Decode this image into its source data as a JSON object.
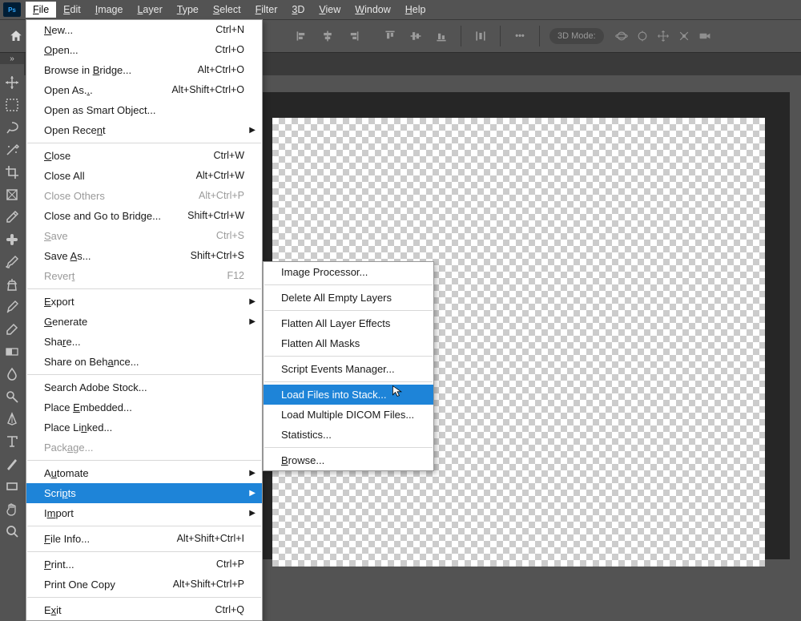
{
  "app": {
    "logo_text": "Ps"
  },
  "menubar": [
    "File",
    "Edit",
    "Image",
    "Layer",
    "Type",
    "Select",
    "Filter",
    "3D",
    "View",
    "Window",
    "Help"
  ],
  "optionsbar": {
    "mode_label": "3D Mode:"
  },
  "file_menu": {
    "groups": [
      [
        {
          "label": "New...",
          "u": 0,
          "shortcut": "Ctrl+N"
        },
        {
          "label": "Open...",
          "u": 0,
          "shortcut": "Ctrl+O"
        },
        {
          "label": "Browse in Bridge...",
          "u": 10,
          "shortcut": "Alt+Ctrl+O"
        },
        {
          "label": "Open As...",
          "u": 8,
          "shortcut": "Alt+Shift+Ctrl+O"
        },
        {
          "label": "Open as Smart Object..."
        },
        {
          "label": "Open Recent",
          "u": 9,
          "submenu": true
        }
      ],
      [
        {
          "label": "Close",
          "u": 0,
          "shortcut": "Ctrl+W"
        },
        {
          "label": "Close All",
          "shortcut": "Alt+Ctrl+W"
        },
        {
          "label": "Close Others",
          "shortcut": "Alt+Ctrl+P",
          "disabled": true
        },
        {
          "label": "Close and Go to Bridge...",
          "shortcut": "Shift+Ctrl+W"
        },
        {
          "label": "Save",
          "u": 0,
          "shortcut": "Ctrl+S",
          "disabled": true
        },
        {
          "label": "Save As...",
          "u": 5,
          "shortcut": "Shift+Ctrl+S"
        },
        {
          "label": "Revert",
          "u": 5,
          "shortcut": "F12",
          "disabled": true
        }
      ],
      [
        {
          "label": "Export",
          "u": 0,
          "submenu": true
        },
        {
          "label": "Generate",
          "u": 0,
          "submenu": true
        },
        {
          "label": "Share...",
          "u": 3
        },
        {
          "label": "Share on Behance...",
          "u": 12
        }
      ],
      [
        {
          "label": "Search Adobe Stock..."
        },
        {
          "label": "Place Embedded...",
          "u": 6
        },
        {
          "label": "Place Linked...",
          "u": 8
        },
        {
          "label": "Package...",
          "u": 4,
          "disabled": true
        }
      ],
      [
        {
          "label": "Automate",
          "u": 1,
          "submenu": true
        },
        {
          "label": "Scripts",
          "u": 4,
          "submenu": true,
          "highlight": true
        },
        {
          "label": "Import",
          "u": 1,
          "submenu": true
        }
      ],
      [
        {
          "label": "File Info...",
          "u": 0,
          "shortcut": "Alt+Shift+Ctrl+I"
        }
      ],
      [
        {
          "label": "Print...",
          "u": 0,
          "shortcut": "Ctrl+P"
        },
        {
          "label": "Print One Copy",
          "shortcut": "Alt+Shift+Ctrl+P"
        }
      ],
      [
        {
          "label": "Exit",
          "u": 1,
          "shortcut": "Ctrl+Q"
        }
      ]
    ]
  },
  "scripts_menu": {
    "groups": [
      [
        {
          "label": "Image Processor..."
        }
      ],
      [
        {
          "label": "Delete All Empty Layers"
        }
      ],
      [
        {
          "label": "Flatten All Layer Effects"
        },
        {
          "label": "Flatten All Masks"
        }
      ],
      [
        {
          "label": "Script Events Manager..."
        }
      ],
      [
        {
          "label": "Load Files into Stack...",
          "highlight": true
        },
        {
          "label": "Load Multiple DICOM Files..."
        },
        {
          "label": "Statistics..."
        }
      ],
      [
        {
          "label": "Browse...",
          "u": 0
        }
      ]
    ]
  },
  "tools": [
    "move",
    "marquee",
    "lasso",
    "wand",
    "crop",
    "frame",
    "eyedrop",
    "heal",
    "brush",
    "clone",
    "history",
    "eraser",
    "gradient",
    "blur",
    "dodge",
    "pen",
    "type",
    "path",
    "rect",
    "hand",
    "zoom"
  ],
  "colors": {
    "highlight": "#1e84d8"
  }
}
